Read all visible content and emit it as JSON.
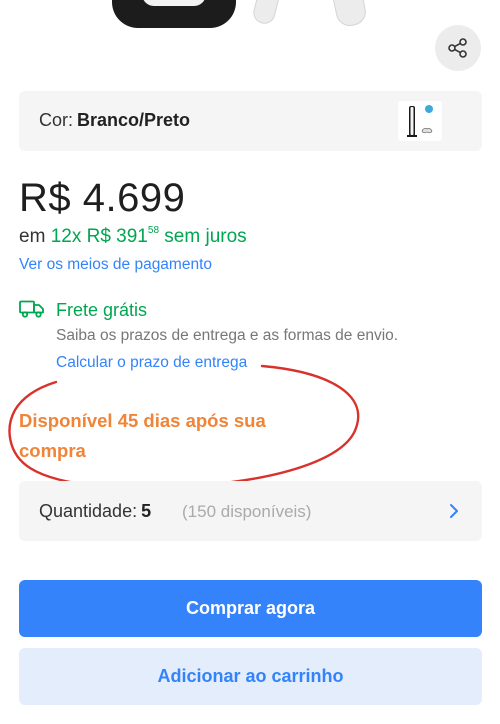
{
  "product": {
    "image_alt": "console-and-controllers-image",
    "share_icon": "share-icon"
  },
  "color": {
    "label": "Cor:",
    "value": "Branco/Preto",
    "thumbnail_icon": "console-thumbnail"
  },
  "price": {
    "main": "R$ 4.699",
    "installments_prefix": "em",
    "installments_count": "12x",
    "installments_value": "R$ 391",
    "installments_cents": "58",
    "installments_suffix": "sem juros",
    "payment_link": "Ver os meios de pagamento"
  },
  "shipping": {
    "icon": "truck-icon",
    "title": "Frete grátis",
    "description": "Saiba os prazos de entrega e as formas de envio.",
    "link": "Calcular o prazo de entrega"
  },
  "availability": {
    "text": "Disponível 45 dias após sua compra"
  },
  "quantity": {
    "label": "Quantidade:",
    "value": "5",
    "available": "(150 disponíveis)",
    "chevron_icon": "chevron-right-icon"
  },
  "actions": {
    "buy_now": "Comprar agora",
    "add_to_cart": "Adicionar ao carrinho"
  },
  "colors": {
    "accent_blue": "#3483fa",
    "green": "#00a650",
    "orange": "#f08438",
    "annotation_red": "#d9312b",
    "light_blue": "#e3edfb",
    "panel_gray": "#f5f5f5"
  }
}
